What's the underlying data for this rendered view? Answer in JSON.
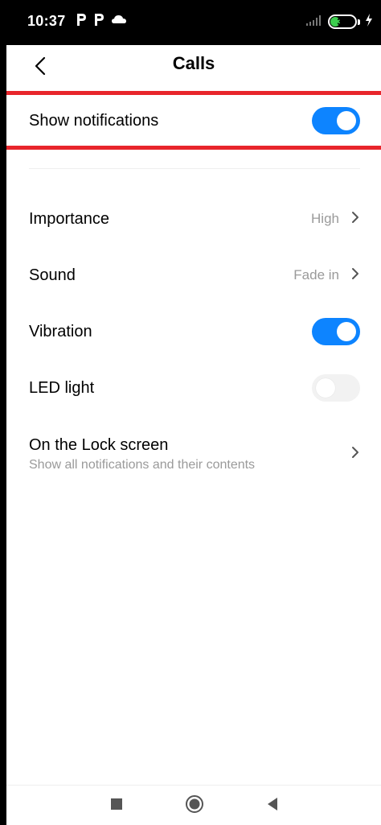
{
  "status_bar": {
    "time": "10:37",
    "notification_icons": [
      "p-app-icon",
      "p-app-icon",
      "cloud-icon"
    ],
    "battery_level": "39",
    "battery_fraction": 0.39,
    "charging": true
  },
  "header": {
    "title": "Calls",
    "back_icon": "chevron-left-icon"
  },
  "settings": {
    "show_notifications": {
      "label": "Show notifications",
      "enabled": true
    },
    "importance": {
      "label": "Importance",
      "value": "High"
    },
    "sound": {
      "label": "Sound",
      "value": "Fade in"
    },
    "vibration": {
      "label": "Vibration",
      "enabled": true
    },
    "led_light": {
      "label": "LED light",
      "enabled": false
    },
    "lock_screen": {
      "label": "On the Lock screen",
      "description": "Show all notifications and their contents"
    }
  },
  "nav_bar": {
    "icons": [
      "recents-square-icon",
      "home-circle-icon",
      "back-triangle-icon"
    ]
  },
  "colors": {
    "accent": "#0d84ff",
    "highlight_line": "#e8252b",
    "secondary_text": "#9a9a9a",
    "toggle_off": "#f2f2f2"
  }
}
